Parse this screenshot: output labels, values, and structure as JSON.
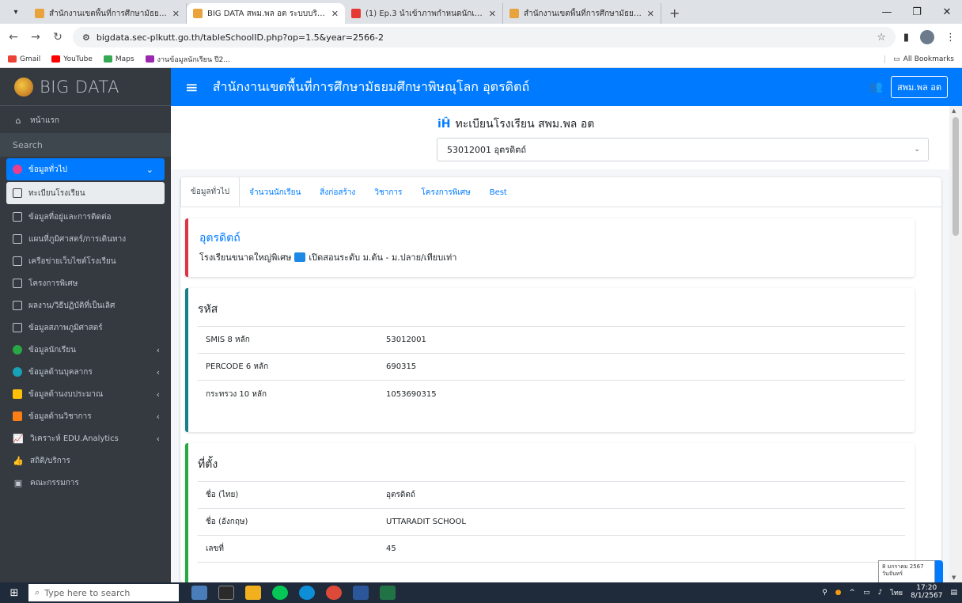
{
  "browser": {
    "tabs": [
      {
        "title": "สำนักงานเขตพื้นที่การศึกษามัธยมศึกษา",
        "color": "#e8a33d",
        "active": false
      },
      {
        "title": "BIG DATA สพม.พล อต ระบบบริหาร",
        "color": "#e8a33d",
        "active": true
      },
      {
        "title": "(1) Ep.3 นำเข้าภาพกำหนดนักเรียน",
        "color": "#e53935",
        "active": false
      },
      {
        "title": "สำนักงานเขตพื้นที่การศึกษามัธยมศึกษา",
        "color": "#e8a33d",
        "active": false
      }
    ],
    "url": "bigdata.sec-plkutt.go.th/tableSchoolID.php?op=1.5&year=2566-2",
    "bookmarks": [
      {
        "label": "Gmail",
        "color": "#ea4335"
      },
      {
        "label": "YouTube",
        "color": "#ff0000"
      },
      {
        "label": "Maps",
        "color": "#34a853"
      },
      {
        "label": "งานข้อมูลนักเรียน ปี2...",
        "color": "#9c27b0"
      }
    ],
    "all_bookmarks": "All Bookmarks"
  },
  "brand": {
    "name": "BIG DATA"
  },
  "topnav": {
    "title": "สำนักงานเขตพื้นที่การศึกษามัธยมศึกษาพิษณุโลก อุตรดิตถ์",
    "user_label": "สพม.พล อต"
  },
  "sidebar": {
    "home": "หน้าแรก",
    "search": "Search",
    "general": "ข้อมูลทั่วไป",
    "items": [
      {
        "label": "ทะเบียนโรงเรียน",
        "active": true
      },
      {
        "label": "ข้อมูลที่อยู่และการติดต่อ"
      },
      {
        "label": "แผนที่ภูมิศาสตร์/การเดินทาง"
      },
      {
        "label": "เครือข่ายเว็บไซต์โรงเรียน"
      },
      {
        "label": "โครงการพิเศษ"
      },
      {
        "label": "ผลงาน/วิธีปฏิบัติที่เป็นเลิศ"
      },
      {
        "label": "ข้อมูลสภาพภูมิศาสตร์"
      }
    ],
    "groups": [
      {
        "label": "ข้อมูลนักเรียน",
        "color": "#28a745"
      },
      {
        "label": "ข้อมูลด้านบุคลากร",
        "color": "#17a2b8"
      },
      {
        "label": "ข้อมูลด้านงบประมาณ",
        "color": "#ffc107"
      },
      {
        "label": "ข้อมูลด้านวิชาการ",
        "color": "#fd7e14"
      },
      {
        "label": "วิเคราะห์ EDU.Analytics",
        "color": "#ffc107"
      }
    ],
    "bottom": [
      {
        "label": "สถิติ/บริการ"
      },
      {
        "label": "คณะกรรมการ"
      }
    ]
  },
  "page": {
    "heading": "ทะเบียนโรงเรียน สพม.พล อต",
    "school_select": "53012001 อุตรดิตถ์",
    "tabs": [
      "ข้อมูลทั่วไป",
      "จำนวนนักเรียน",
      "สิ่งก่อสร้าง",
      "วิชาการ",
      "โครงการพิเศษ",
      "Best"
    ],
    "callout": {
      "title": "อุตรดิตถ์",
      "desc_a": "โรงเรียนขนาดใหญ่พิเศษ",
      "desc_b": "เปิดสอนระดับ ม.ต้น - ม.ปลาย/เทียบเท่า"
    },
    "code_card": {
      "title": "รหัส",
      "rows": [
        {
          "k": "SMIS 8 หลัก",
          "v": "53012001"
        },
        {
          "k": "PERCODE 6 หลัก",
          "v": "690315"
        },
        {
          "k": "กระทรวง 10 หลัก",
          "v": "1053690315"
        }
      ]
    },
    "loc_card": {
      "title": "ที่ตั้ง",
      "rows": [
        {
          "k": "ชื่อ (ไทย)",
          "v": "อุตรดิตถ์"
        },
        {
          "k": "ชื่อ (อังกฤษ)",
          "v": "UTTARADIT SCHOOL"
        },
        {
          "k": "เลขที่",
          "v": "45"
        }
      ]
    }
  },
  "tooltip": {
    "line1": "8 มกราคม 2567",
    "line2": "วันจันทร์"
  },
  "taskbar": {
    "search_placeholder": "Type here to search",
    "lang": "ไทย",
    "time": "17:20",
    "date": "8/1/2567"
  },
  "colors": {
    "primary": "#007bff",
    "sidebar": "#343a40",
    "danger": "#dc3545",
    "success": "#28a745"
  }
}
